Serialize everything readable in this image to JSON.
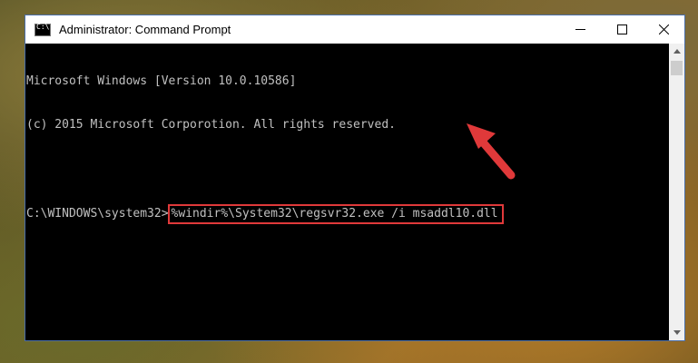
{
  "window": {
    "title": "Administrator: Command Prompt",
    "icon_text": "C:\\"
  },
  "controls": {
    "minimize_icon": "minimize-icon",
    "maximize_icon": "maximize-icon",
    "close_icon": "close-icon"
  },
  "console": {
    "line1": "Microsoft Windows [Version 10.0.10586]",
    "line2": "(c) 2015 Microsoft Corporotion. All rights reserved.",
    "prompt": "C:\\WINDOWS\\system32>",
    "command": "%windir%\\System32\\regsvr32.exe /i msaddl10.dll"
  },
  "colors": {
    "highlight": "#e0393a",
    "arrow": "#e0393a"
  }
}
